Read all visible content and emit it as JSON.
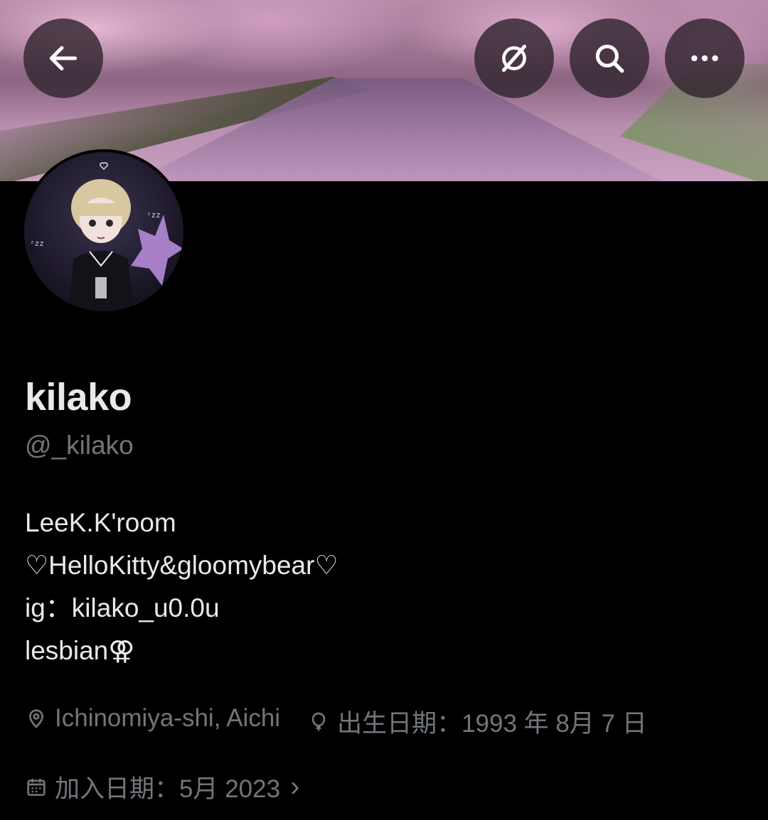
{
  "profile": {
    "display_name": "kilako",
    "handle": "@_kilako",
    "bio_lines": [
      "LeeK.K'room",
      "♡HelloKitty&gloomybear♡",
      "ig：kilako_u0.0u",
      "lesbian⚢"
    ],
    "location": "Ichinomiya-shi, Aichi",
    "birthday": "出生日期：1993 年 8月 7 日",
    "joined": "加入日期：5月 2023",
    "joined_chevron": "›"
  },
  "icons": {
    "back": "arrow-left-icon",
    "grok": "grok-icon",
    "search": "search-icon",
    "more": "more-icon",
    "location": "location-pin-icon",
    "birthday": "balloon-icon",
    "calendar": "calendar-icon"
  },
  "colors": {
    "background": "#000000",
    "text_primary": "#e7e9ea",
    "text_secondary": "#71767b"
  }
}
